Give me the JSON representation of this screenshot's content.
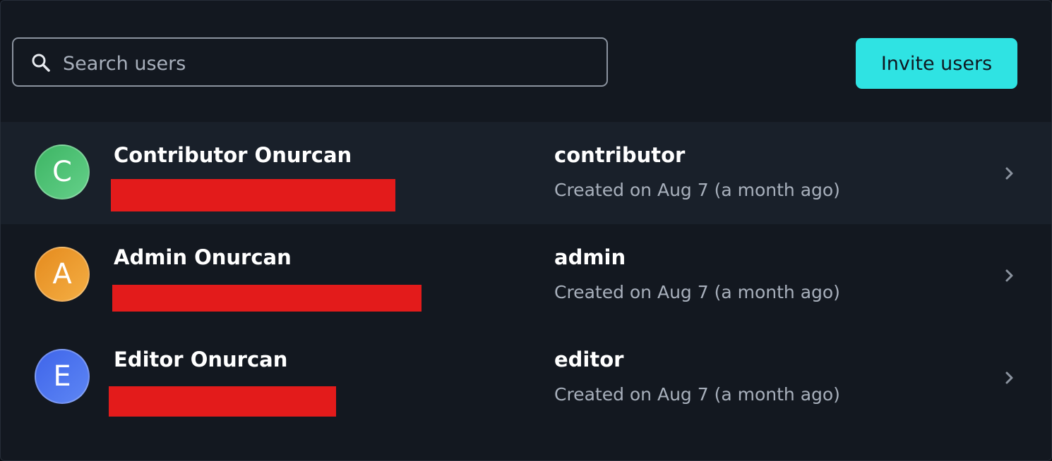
{
  "search": {
    "placeholder": "Search users",
    "value": ""
  },
  "invite_button": {
    "label": "Invite users",
    "color": "#2fe3e3"
  },
  "users": [
    {
      "avatar_letter": "C",
      "avatar_colors": [
        "#3db564",
        "#64d089"
      ],
      "name": "Contributor Onurcan",
      "role": "contributor",
      "created": "Created on Aug 7 (a month ago)"
    },
    {
      "avatar_letter": "A",
      "avatar_colors": [
        "#e58b1e",
        "#f4ae44"
      ],
      "name": "Admin Onurcan",
      "role": "admin",
      "created": "Created on Aug 7 (a month ago)"
    },
    {
      "avatar_letter": "E",
      "avatar_colors": [
        "#3f65ea",
        "#5d86f4"
      ],
      "name": "Editor Onurcan",
      "role": "editor",
      "created": "Created on Aug 7 (a month ago)"
    }
  ],
  "icons": {
    "search": "search-icon",
    "row_action": "chevron-right-icon"
  }
}
